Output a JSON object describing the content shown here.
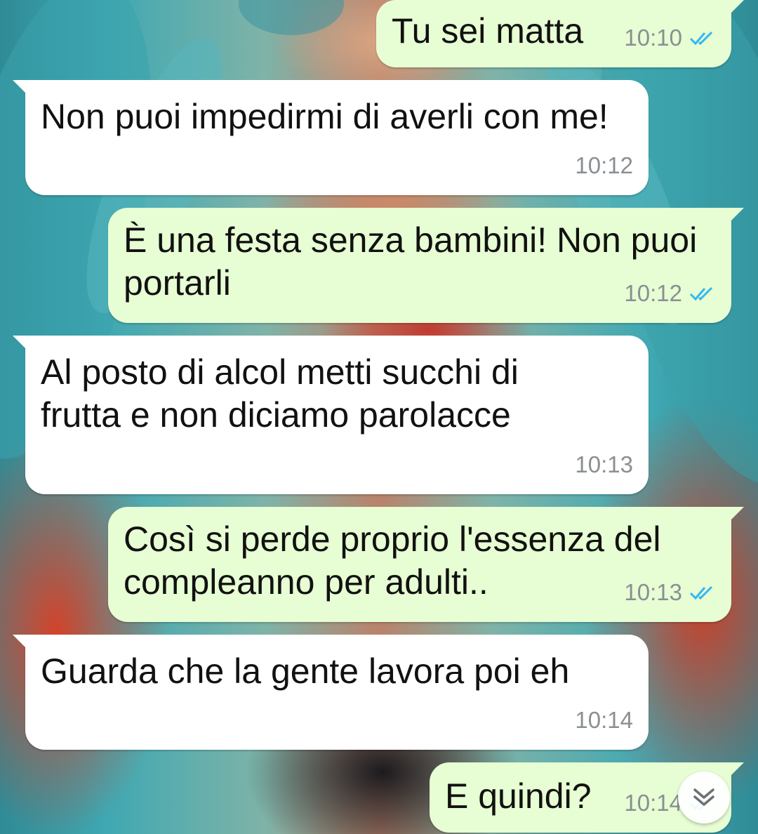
{
  "colors": {
    "incoming_bubble": "#ffffff",
    "outgoing_bubble": "#e7fdd3",
    "timestamp": "#8a8f93",
    "read_ticks": "#34b7f1"
  },
  "messages": [
    {
      "direction": "out",
      "text": "Tu sei matta",
      "time": "10:10",
      "status_icon": "double-check-read-icon"
    },
    {
      "direction": "in",
      "text": "Non puoi impedirmi di averli con me!",
      "time": "10:12"
    },
    {
      "direction": "out",
      "text": "È una festa senza bambini! Non puoi portarli",
      "time": "10:12",
      "status_icon": "double-check-read-icon"
    },
    {
      "direction": "in",
      "text": "Al posto di alcol metti succhi di frutta e non diciamo parolacce",
      "time": "10:13"
    },
    {
      "direction": "out",
      "text": "Così si perde proprio l'essenza del compleanno per adulti..",
      "time": "10:13",
      "status_icon": "double-check-read-icon"
    },
    {
      "direction": "in",
      "text": "Guarda che la gente lavora poi eh",
      "time": "10:14"
    },
    {
      "direction": "out",
      "text": "E quindi?",
      "time": "10:14",
      "status_icon": "double-check-read-icon"
    }
  ],
  "scroll_button": {
    "icon": "double-chevron-down-icon"
  }
}
